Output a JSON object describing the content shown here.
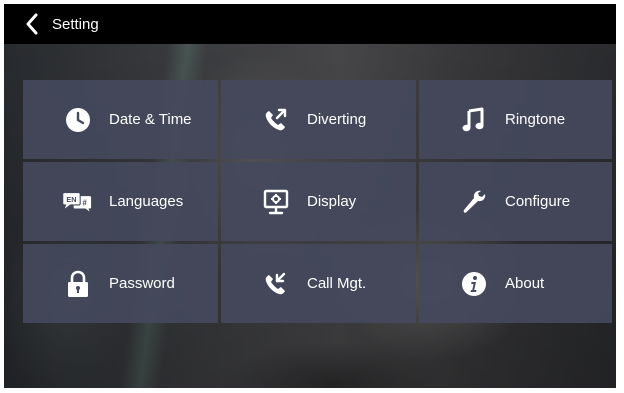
{
  "header": {
    "title": "Setting",
    "back_icon": "chevron-left-icon"
  },
  "menu": {
    "items": [
      {
        "label": "Date & Time",
        "icon": "clock-icon"
      },
      {
        "label": "Diverting",
        "icon": "call-divert-icon"
      },
      {
        "label": "Ringtone",
        "icon": "music-note-icon"
      },
      {
        "label": "Languages",
        "icon": "language-icon",
        "icon_text": "EN"
      },
      {
        "label": "Display",
        "icon": "monitor-icon"
      },
      {
        "label": "Configure",
        "icon": "wrench-icon"
      },
      {
        "label": "Password",
        "icon": "lock-icon"
      },
      {
        "label": "Call Mgt.",
        "icon": "call-management-icon"
      },
      {
        "label": "About",
        "icon": "info-icon"
      }
    ]
  },
  "colors": {
    "header_bg": "#000000",
    "tile_bg": "#44495c",
    "text": "#ffffff"
  }
}
